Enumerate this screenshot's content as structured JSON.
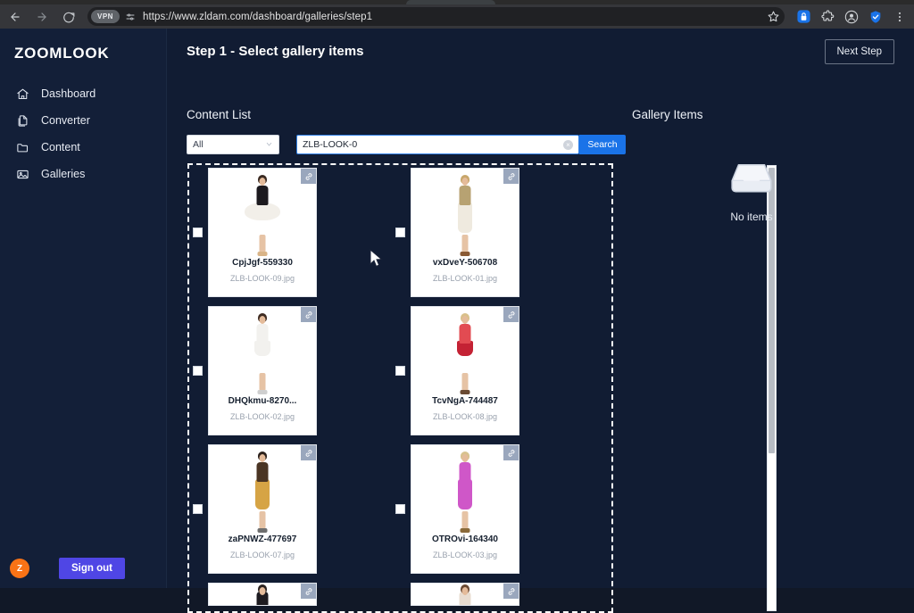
{
  "browser": {
    "url": "https://www.zldam.com/dashboard/galleries/step1",
    "vpn_badge": "VPN",
    "icons": {
      "back": "back-arrow-icon",
      "forward": "forward-arrow-icon",
      "reload": "reload-icon",
      "site_settings": "tune-sliders-icon",
      "bookmark": "star-icon",
      "ext_lock": "lock-extension-icon",
      "ext_puzzle": "extensions-puzzle-icon",
      "profile": "profile-avatar-icon",
      "ext_shield": "shield-check-icon",
      "menu": "three-dot-menu-icon"
    }
  },
  "sidebar": {
    "brand": "ZOOMLOOK",
    "items": [
      {
        "label": "Dashboard",
        "icon": "home-icon"
      },
      {
        "label": "Converter",
        "icon": "copy-document-icon"
      },
      {
        "label": "Content",
        "icon": "folder-icon"
      },
      {
        "label": "Galleries",
        "icon": "image-icon"
      }
    ],
    "avatar_initial": "Z",
    "signout_label": "Sign out"
  },
  "main": {
    "page_title": "Step 1 - Select gallery items",
    "next_step_label": "Next Step",
    "content_list_label": "Content List",
    "gallery_items_label": "Gallery Items"
  },
  "filters": {
    "type_select_value": "All",
    "chevron": "chevron-down-icon",
    "search_value": "ZLB-LOOK-0",
    "search_placeholder": "Search",
    "clear_glyph": "×",
    "search_button_label": "Search"
  },
  "content_items": [
    {
      "title": "CpjJgf-559330",
      "filename": "ZLB-LOOK-09.jpg",
      "checked": false,
      "colors": {
        "hair": "#3a2a22",
        "torso": "#1c1a1f",
        "skirt": "#f2efe9",
        "shoes": "#d9b487"
      },
      "skirt_shape": "flare"
    },
    {
      "title": "vxDveY-506708",
      "filename": "ZLB-LOOK-01.jpg",
      "checked": false,
      "colors": {
        "hair": "#c8a66a",
        "torso": "#b7a272",
        "skirt": "#efeadf",
        "shoes": "#8a5a34"
      },
      "skirt_shape": "long"
    },
    {
      "title": "DHQkmu-8270...",
      "filename": "ZLB-LOOK-02.jpg",
      "checked": false,
      "colors": {
        "hair": "#3f2c22",
        "torso": "#f2f1ee",
        "skirt": "#f2f1ee",
        "shoes": "#cfcfcf"
      },
      "skirt_shape": "short"
    },
    {
      "title": "TcvNgA-744487",
      "filename": "ZLB-LOOK-08.jpg",
      "checked": false,
      "colors": {
        "hair": "#d9c08a",
        "torso": "#e24b52",
        "skirt": "#c42234",
        "shoes": "#6b4b33"
      },
      "skirt_shape": "short"
    },
    {
      "title": "zaPNWZ-477697",
      "filename": "ZLB-LOOK-07.jpg",
      "checked": false,
      "colors": {
        "hair": "#2c211c",
        "torso": "#4a3524",
        "skirt": "#d6a445",
        "shoes": "#6e6e6e"
      },
      "skirt_shape": "long"
    },
    {
      "title": "OTROvi-164340",
      "filename": "ZLB-LOOK-03.jpg",
      "checked": false,
      "colors": {
        "hair": "#d8c28e",
        "torso": "#cf57c8",
        "skirt": "#cf57c8",
        "shoes": "#8a6a3a"
      },
      "skirt_shape": "long"
    }
  ],
  "content_items_partial": [
    {
      "filename": "",
      "colors": {
        "hair": "#2b2320",
        "torso": "#1d1b20"
      }
    },
    {
      "filename": "",
      "colors": {
        "hair": "#6b4a33",
        "torso": "#e8dcd0"
      }
    }
  ],
  "link_badge_icon": "chain-link-icon",
  "gallery_panel": {
    "empty_icon": "inbox-tray-icon",
    "empty_label": "No items"
  },
  "cursor": {
    "icon": "mouse-arrow-cursor"
  },
  "colors": {
    "app_bg": "#111c33",
    "sidebar_bg": "#131f38",
    "accent_blue": "#1a73e8",
    "signout_purple": "#4f46e5",
    "avatar_orange": "#f97316",
    "dashed_border": "#ffffff"
  }
}
